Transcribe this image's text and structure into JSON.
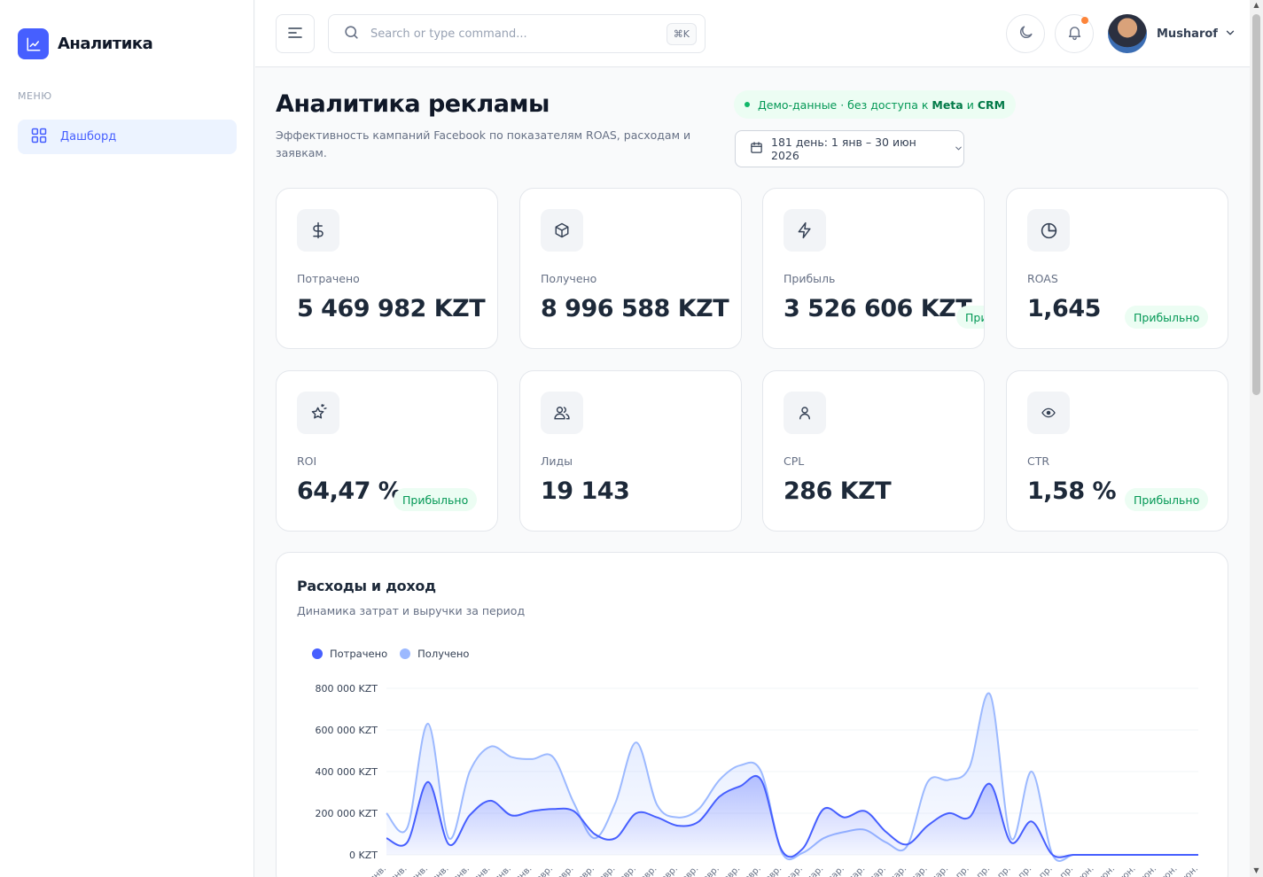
{
  "app": {
    "name": "Аналитика"
  },
  "sidebar": {
    "menu_label": "МЕНЮ",
    "items": [
      {
        "label": "Дашборд",
        "icon": "grid-icon",
        "active": true
      }
    ]
  },
  "header": {
    "search_placeholder": "Search or type command...",
    "shortcut": "⌘K",
    "user_name": "Musharof"
  },
  "page": {
    "title": "Аналитика рекламы",
    "subtitle": "Эффективность кампаний Facebook по показателям ROAS, расходам и заявкам.",
    "demo_note": {
      "prefix": "Демо-данные · без доступа к",
      "meta": "Meta",
      "and": "и",
      "crm": "CRM"
    },
    "date_range": "181 день: 1 янв – 30 июн 2026"
  },
  "metrics": [
    {
      "label": "Потрачено",
      "value": "5 469 982 KZT",
      "icon": "dollar-icon",
      "badge": ""
    },
    {
      "label": "Получено",
      "value": "8 996 588 KZT",
      "icon": "box-icon",
      "badge": ""
    },
    {
      "label": "Прибыль",
      "value": "3 526 606 KZT",
      "icon": "bolt-icon",
      "badge": "Прибыльно"
    },
    {
      "label": "ROAS",
      "value": "1,645",
      "icon": "pie-icon",
      "badge": "Прибыльно"
    },
    {
      "label": "ROI",
      "value": "64,47 %",
      "icon": "star-icon",
      "badge": "Прибыльно"
    },
    {
      "label": "Лиды",
      "value": "19 143",
      "icon": "users-icon",
      "badge": ""
    },
    {
      "label": "CPL",
      "value": "286 KZT",
      "icon": "user-icon",
      "badge": ""
    },
    {
      "label": "CTR",
      "value": "1,58 %",
      "icon": "eye-icon",
      "badge": "Прибыльно"
    }
  ],
  "chart": {
    "title": "Расходы и доход",
    "subtitle": "Динамика затрат и выручки за период"
  },
  "chart_data": {
    "type": "area",
    "ylim": [
      0,
      800000
    ],
    "yticks": [
      "0 KZT",
      "200 000 KZT",
      "400 000 KZT",
      "600 000 KZT",
      "800 000 KZT"
    ],
    "y_tick_values": [
      0,
      200000,
      400000,
      600000,
      800000
    ],
    "x": [
      "янв.",
      "янв.",
      "янв.",
      "янв.",
      "янв.",
      "янв.",
      "янв.",
      "янв.",
      "февр.",
      "февр.",
      "февр.",
      "февр.",
      "февр.",
      "февр.",
      "февр.",
      "февр.",
      "февр.",
      "февр.",
      "февр.",
      "февр.",
      "мар.",
      "мар.",
      "мар.",
      "мар.",
      "мар.",
      "мар.",
      "мар.",
      "мар.",
      "апр.",
      "апр.",
      "апр.",
      "апр.",
      "апр.",
      "апр.",
      "июн.",
      "июн.",
      "июн.",
      "июн.",
      "июн.",
      "июн."
    ],
    "series": [
      {
        "name": "Потрачено",
        "color": "#465fff",
        "values": [
          80000,
          60000,
          350000,
          50000,
          190000,
          260000,
          190000,
          210000,
          220000,
          210000,
          100000,
          80000,
          200000,
          180000,
          140000,
          160000,
          280000,
          330000,
          360000,
          20000,
          30000,
          220000,
          180000,
          210000,
          110000,
          50000,
          140000,
          200000,
          180000,
          340000,
          60000,
          160000,
          0,
          0,
          0,
          0,
          0,
          0,
          0,
          0
        ]
      },
      {
        "name": "Получено",
        "color": "#9cb9ff",
        "values": [
          200000,
          130000,
          630000,
          80000,
          400000,
          520000,
          470000,
          460000,
          470000,
          250000,
          80000,
          250000,
          540000,
          240000,
          180000,
          220000,
          360000,
          430000,
          400000,
          10000,
          10000,
          80000,
          110000,
          120000,
          60000,
          40000,
          350000,
          360000,
          420000,
          770000,
          80000,
          400000,
          0,
          0,
          0,
          0,
          0,
          0,
          0,
          0
        ]
      }
    ]
  }
}
